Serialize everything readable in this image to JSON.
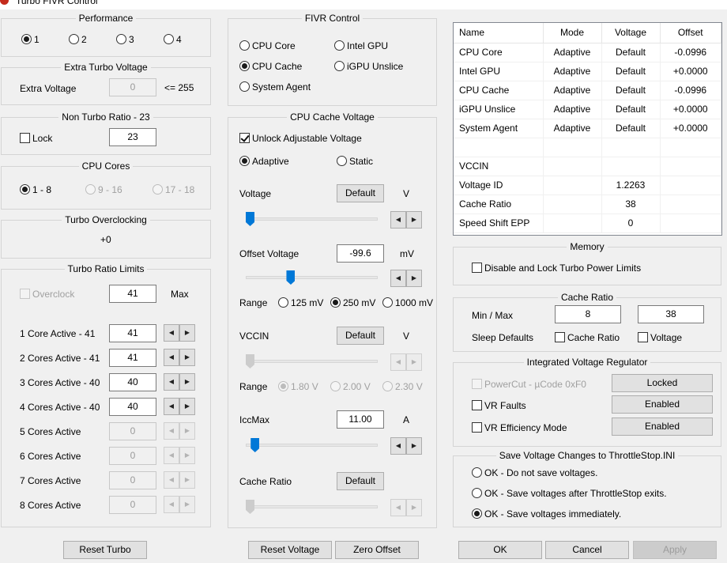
{
  "window": {
    "title": "Turbo FIVR Control"
  },
  "performance": {
    "legend": "Performance",
    "options": [
      "1",
      "2",
      "3",
      "4"
    ],
    "selected": "1"
  },
  "extra_turbo": {
    "legend": "Extra Turbo Voltage",
    "label": "Extra Voltage",
    "value": "0",
    "hint": "<= 255"
  },
  "non_turbo": {
    "legend": "Non Turbo Ratio - 23",
    "lock_label": "Lock",
    "lock_checked": false,
    "value": "23"
  },
  "cpu_cores": {
    "legend": "CPU Cores",
    "options": [
      "1 - 8",
      "9 - 16",
      "17 - 18"
    ],
    "selected": "1 - 8"
  },
  "turbo_oc": {
    "legend": "Turbo Overclocking",
    "value": "+0"
  },
  "turbo_limits": {
    "legend": "Turbo Ratio Limits",
    "overclock_label": "Overclock",
    "overclock_value": "41",
    "max_label": "Max",
    "rows": [
      {
        "label": "1 Core  Active - 41",
        "value": "41",
        "enabled": true
      },
      {
        "label": "2 Cores Active - 41",
        "value": "41",
        "enabled": true
      },
      {
        "label": "3 Cores Active - 40",
        "value": "40",
        "enabled": true
      },
      {
        "label": "4 Cores Active - 40",
        "value": "40",
        "enabled": true
      },
      {
        "label": "5 Cores Active",
        "value": "0",
        "enabled": false
      },
      {
        "label": "6 Cores Active",
        "value": "0",
        "enabled": false
      },
      {
        "label": "7 Cores Active",
        "value": "0",
        "enabled": false
      },
      {
        "label": "8 Cores Active",
        "value": "0",
        "enabled": false
      }
    ],
    "reset_label": "Reset Turbo"
  },
  "fivr_control": {
    "legend": "FIVR Control",
    "options": [
      "CPU Core",
      "Intel GPU",
      "CPU Cache",
      "iGPU Unslice",
      "System Agent"
    ],
    "selected": "CPU Cache"
  },
  "cache_voltage": {
    "legend": "CPU Cache Voltage",
    "unlock_label": "Unlock Adjustable Voltage",
    "unlock_checked": true,
    "mode_adaptive": "Adaptive",
    "mode_static": "Static",
    "mode_selected": "Adaptive",
    "voltage_label": "Voltage",
    "voltage_button": "Default",
    "voltage_unit": "V",
    "offset_label": "Offset Voltage",
    "offset_value": "-99.6",
    "offset_unit": "mV",
    "range_label": "Range",
    "range_options": [
      "125 mV",
      "250 mV",
      "1000 mV"
    ],
    "range_selected": "250 mV",
    "vccin_label": "VCCIN",
    "vccin_button": "Default",
    "vccin_unit": "V",
    "vccin_range_label": "Range",
    "vccin_range_options": [
      "1.80 V",
      "2.00 V",
      "2.30 V"
    ],
    "vccin_range_selected": "1.80 V",
    "iccmax_label": "IccMax",
    "iccmax_value": "11.00",
    "iccmax_unit": "A",
    "cache_ratio_label": "Cache Ratio",
    "cache_ratio_button": "Default"
  },
  "voltage_buttons": {
    "reset_voltage": "Reset Voltage",
    "zero_offset": "Zero Offset"
  },
  "status_table": {
    "headers": [
      "Name",
      "Mode",
      "Voltage",
      "Offset"
    ],
    "rows": [
      [
        "CPU Core",
        "Adaptive",
        "Default",
        "-0.0996"
      ],
      [
        "Intel GPU",
        "Adaptive",
        "Default",
        "+0.0000"
      ],
      [
        "CPU Cache",
        "Adaptive",
        "Default",
        "-0.0996"
      ],
      [
        "iGPU Unslice",
        "Adaptive",
        "Default",
        "+0.0000"
      ],
      [
        "System Agent",
        "Adaptive",
        "Default",
        "+0.0000"
      ],
      [
        "",
        "",
        "",
        ""
      ],
      [
        "VCCIN",
        "",
        "",
        ""
      ],
      [
        "Voltage ID",
        "",
        "1.2263",
        ""
      ],
      [
        "Cache Ratio",
        "",
        "38",
        ""
      ],
      [
        "Speed Shift EPP",
        "",
        "0",
        ""
      ]
    ]
  },
  "memory": {
    "legend": "Memory",
    "disable_lock_label": "Disable and Lock Turbo Power Limits",
    "disable_lock_checked": false
  },
  "cache_ratio": {
    "legend": "Cache Ratio",
    "minmax_label": "Min / Max",
    "min_value": "8",
    "max_value": "38",
    "sleep_label": "Sleep Defaults",
    "sleep_cache_ratio": "Cache Ratio",
    "sleep_voltage": "Voltage"
  },
  "ivr": {
    "legend": "Integrated Voltage Regulator",
    "powercut_label": "PowerCut  -  µCode 0xF0",
    "powercut_button": "Locked",
    "vr_faults_label": "VR Faults",
    "vr_faults_button": "Enabled",
    "vr_eff_label": "VR Efficiency Mode",
    "vr_eff_button": "Enabled"
  },
  "save_ini": {
    "legend": "Save Voltage Changes to ThrottleStop.INI",
    "options": [
      "OK - Do not save voltages.",
      "OK - Save voltages after ThrottleStop exits.",
      "OK - Save voltages immediately."
    ],
    "selected": 2
  },
  "dialog_buttons": {
    "ok": "OK",
    "cancel": "Cancel",
    "apply": "Apply"
  },
  "sliders": {
    "voltage_pos": 0.0,
    "offset_pos": 0.33,
    "vccin_pos": 0.0,
    "iccmax_pos": 0.04,
    "cache_ratio_pos": 0.0
  },
  "colors": {
    "accent": "#0078d7",
    "window_bg": "#f0f0f0",
    "group_border": "#d4d4d4"
  }
}
